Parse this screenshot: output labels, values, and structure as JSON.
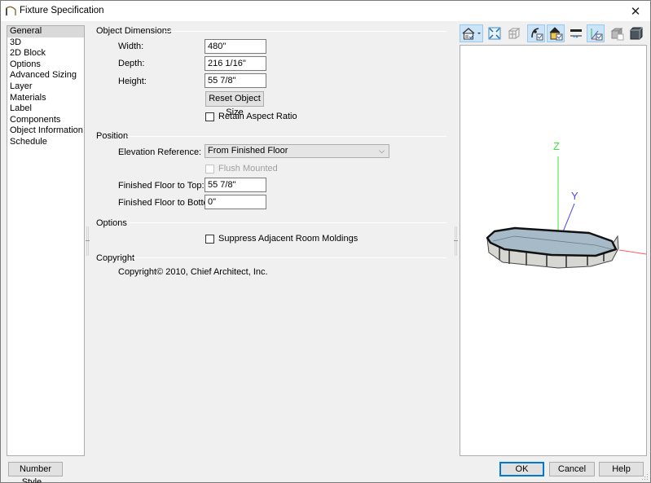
{
  "window": {
    "title": "Fixture Specification",
    "close_glyph": "✕"
  },
  "sidebar": {
    "items": [
      {
        "label": "General",
        "selected": true
      },
      {
        "label": "3D"
      },
      {
        "label": "2D Block"
      },
      {
        "label": "Options"
      },
      {
        "label": "Advanced Sizing"
      },
      {
        "label": "Layer"
      },
      {
        "label": "Materials"
      },
      {
        "label": "Label"
      },
      {
        "label": "Components"
      },
      {
        "label": "Object Information"
      },
      {
        "label": "Schedule"
      }
    ]
  },
  "object_dimensions": {
    "group_label": "Object Dimensions",
    "width_label": "Width:",
    "width_value": "480\"",
    "depth_label": "Depth:",
    "depth_value": "216 1/16\"",
    "height_label": "Height:",
    "height_value": "55 7/8\"",
    "reset_button": "Reset Object Size",
    "retain_aspect_label": "Retain Aspect Ratio",
    "retain_aspect_checked": false
  },
  "position": {
    "group_label": "Position",
    "elevation_reference_label": "Elevation Reference:",
    "elevation_reference_value": "From Finished Floor",
    "flush_mounted_label": "Flush Mounted",
    "flush_mounted_checked": false,
    "flush_mounted_enabled": false,
    "ff_top_label": "Finished Floor to Top:",
    "ff_top_value": "55 7/8\"",
    "ff_bottom_label": "Finished Floor to Bottom:",
    "ff_bottom_value": "0\""
  },
  "options": {
    "group_label": "Options",
    "suppress_moldings_label": "Suppress Adjacent Room Moldings",
    "suppress_moldings_checked": false
  },
  "copyright": {
    "group_label": "Copyright",
    "text": "Copyright© 2010, Chief Architect, Inc."
  },
  "preview": {
    "toolbar_icons": [
      {
        "name": "view-mode-icon",
        "active": true,
        "dropdown": true
      },
      {
        "name": "fill-window-icon",
        "active": false
      },
      {
        "name": "wireframe-icon",
        "active": false
      },
      {
        "name": "show-axes-rotate-icon",
        "active": true
      },
      {
        "name": "color-render-icon",
        "active": true
      },
      {
        "name": "floor-plane-icon",
        "active": false
      },
      {
        "name": "xyz-axes-icon",
        "active": true
      },
      {
        "name": "glass-render-icon",
        "active": false
      },
      {
        "name": "box-view-icon",
        "active": false
      }
    ],
    "axis_labels": {
      "z": "Z",
      "y": "Y"
    },
    "axis_colors": {
      "x": "#ff5a5a",
      "y": "#4a4ae6",
      "z": "#39e639"
    }
  },
  "footer": {
    "number_style_button": "Number Style...",
    "ok_button": "OK",
    "cancel_button": "Cancel",
    "help_button": "Help"
  }
}
